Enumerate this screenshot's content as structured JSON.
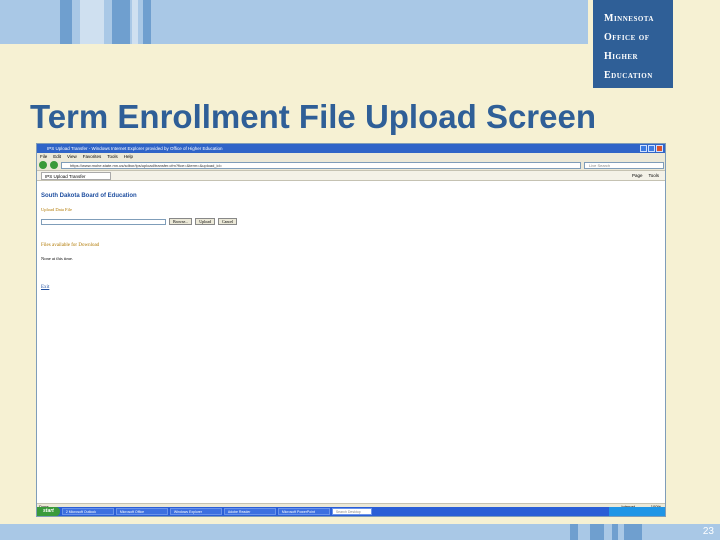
{
  "logo": {
    "lines": [
      "Minnesota",
      "Office of",
      "Higher",
      "Education"
    ]
  },
  "slide": {
    "title": "Term Enrollment File Upload Screen",
    "page_number": "23"
  },
  "browser": {
    "title": "IPS Upload Transfer - Windows Internet Explorer provided by Office of Higher Education",
    "menu": [
      "File",
      "Edit",
      "View",
      "Favorites",
      "Tools",
      "Help"
    ],
    "address": "https://www.mohe.state.mn.us/sdbor/ips/upload/transfer.cfm?fice=&term=&upload_id=",
    "search_placeholder": "Live Search",
    "tab_label": "IPS Upload Transfer",
    "tools": [
      "Page",
      "Tools"
    ],
    "status_left": "Done",
    "status_zone": "Internet",
    "status_zoom": "100%"
  },
  "page": {
    "org_name": "South Dakota Board of Education",
    "upload_label": "Upload Data File",
    "browse_label": "Browse...",
    "upload_button": "Upload",
    "cancel_button": "Cancel",
    "files_heading": "Files available for Download",
    "no_files": "None at this time.",
    "exit_link": "Exit"
  },
  "taskbar": {
    "start_label": "start",
    "tasks": [
      "2 Microsoft Outlook",
      "Microsoft Office",
      "Windows Explorer",
      "Adobe Reader",
      "Microsoft PowerPoint"
    ],
    "search_label": "Search Desktop"
  }
}
